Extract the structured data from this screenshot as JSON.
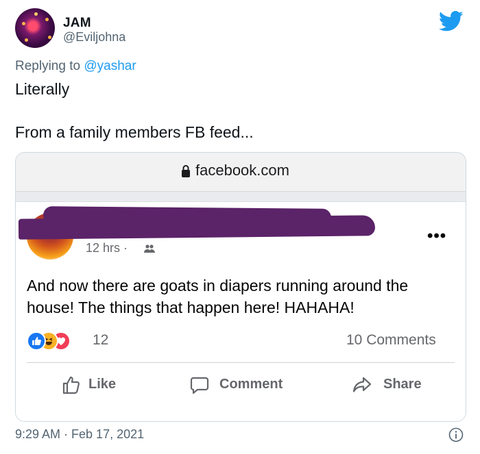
{
  "tweet": {
    "author_name": "JAM",
    "author_handle": "@Eviljohna",
    "reply_prefix": "Replying to",
    "reply_to": "@yashar",
    "text_line1": "Literally",
    "text_line2": "From a family members FB feed...",
    "timestamp": "9:29 AM · Feb 17, 2021",
    "brand_color": "#1d9bf0"
  },
  "screenshot": {
    "url": "facebook.com",
    "post": {
      "time": "12 hrs ·",
      "text": "And now there are goats in diapers running around the house! The things that happen here! HAHAHA!",
      "reaction_count": "12",
      "comment_count": "10 Comments",
      "actions": {
        "like": "Like",
        "comment": "Comment",
        "share": "Share"
      }
    }
  },
  "icons": [
    "twitter-bird-icon",
    "lock-icon",
    "friends-icon",
    "more-icon",
    "like-reaction-icon",
    "haha-reaction-icon",
    "love-reaction-icon",
    "like-icon",
    "comment-icon",
    "share-icon",
    "info-icon"
  ]
}
